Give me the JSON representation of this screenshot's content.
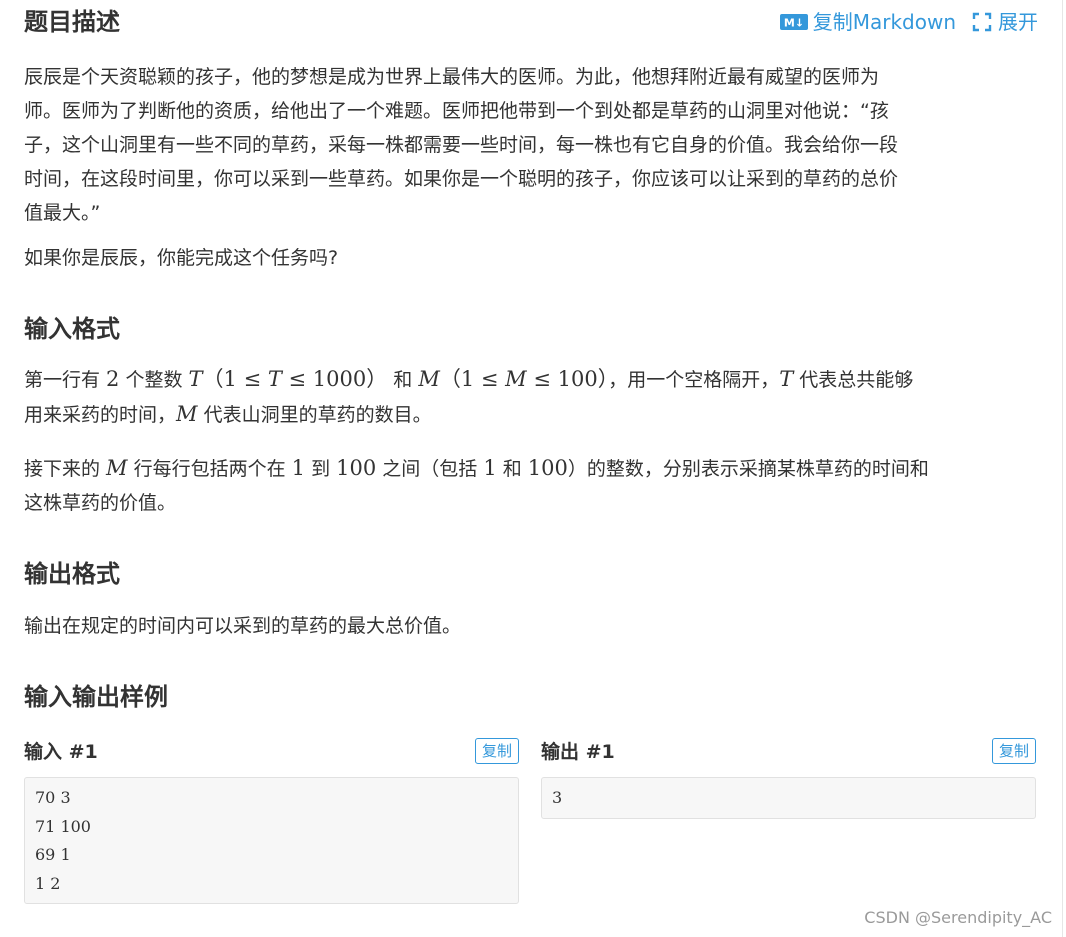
{
  "header": {
    "title": "题目描述",
    "copy_markdown_label": "复制Markdown",
    "expand_label": "展开",
    "md_badge_text": "M↓"
  },
  "description": {
    "lines": [
      "辰辰是个天资聪颖的孩子，他的梦想是成为世界上最伟大的医师。为此，他想拜附近最有威望的医师为",
      "师。医师为了判断他的资质，给他出了一个难题。医师把他带到一个到处都是草药的山洞里对他说：“孩",
      "子，这个山洞里有一些不同的草药，采每一株都需要一些时间，每一株也有它自身的价值。我会给你一段",
      "时间，在这段时间里，你可以采到一些草药。如果你是一个聪明的孩子，你应该可以让采到的草药的总价",
      "值最大。”"
    ],
    "question": "如果你是辰辰，你能完成这个任务吗?"
  },
  "input_format": {
    "title": "输入格式",
    "l1_a": "第一行有 ",
    "l1_num": "2",
    "l1_b": " 个整数 ",
    "var_T": "T",
    "range_T_open": "（1 ≤ ",
    "range_T_close": " ≤ 1000）",
    "l1_and": " 和 ",
    "var_M": "M",
    "range_M_open": "（1 ≤ ",
    "range_M_close": " ≤ 100）",
    "l1_c": "，用一个空格隔开，",
    "l1_d": " 代表总共能够",
    "l2_a": "用来采药的时间，",
    "l2_b": " 代表山洞里的草药的数目。",
    "p2_a": "接下来的 ",
    "p2_b": " 行每行包括两个在 ",
    "num_1": "1",
    "p2_c": " 到 ",
    "num_100": "100",
    "p2_d": " 之间（包括 ",
    "p2_e": " 和 ",
    "p2_f": "）的整数，分别表示采摘某株草药的时间和",
    "p2_line2": "这株草药的价值。"
  },
  "output_format": {
    "title": "输出格式",
    "text": "输出在规定的时间内可以采到的草药的最大总价值。"
  },
  "samples": {
    "title": "输入输出样例",
    "input_label": "输入 #1",
    "output_label": "输出 #1",
    "copy_label": "复制",
    "input_lines": [
      "70 3",
      "71 100",
      "69 1",
      "1 2"
    ],
    "output_lines": [
      "3"
    ]
  },
  "watermark": "CSDN @Serendipity_AC",
  "colors": {
    "accent": "#3498db",
    "text": "#333333",
    "code_bg": "#f7f7f7"
  }
}
